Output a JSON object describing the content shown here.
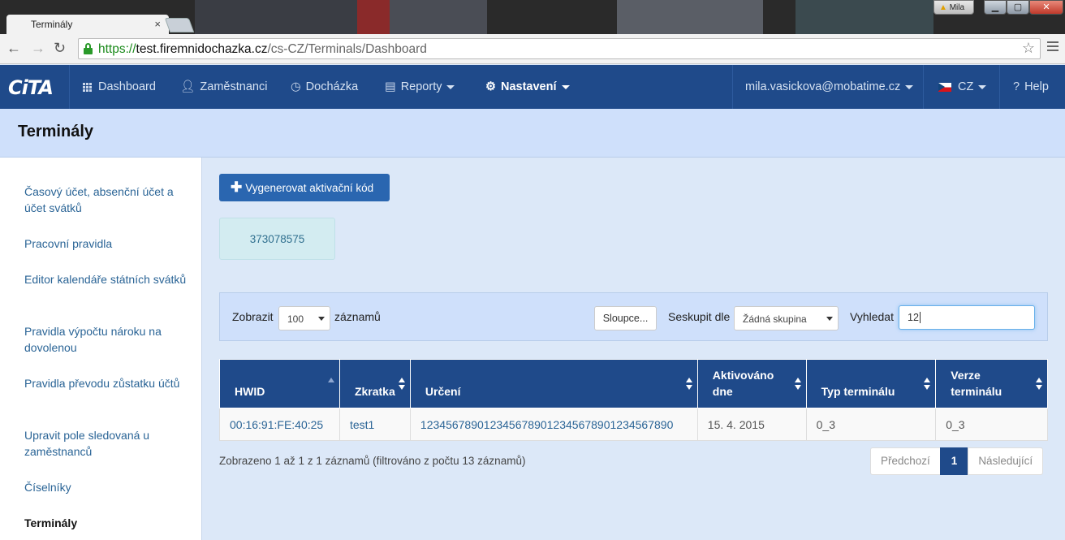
{
  "browser": {
    "tab_title": "Terminály",
    "tab_close": "×",
    "url_proto": "https://",
    "url_host": "test.firemnidochazka.cz",
    "url_path": "/cs-CZ/Terminals/Dashboard",
    "window_user": "Mila"
  },
  "navbar": {
    "brand": "CiTA",
    "items": [
      {
        "label": "Dashboard"
      },
      {
        "label": "Zaměstnanci"
      },
      {
        "label": "Docházka"
      },
      {
        "label": "Reporty"
      },
      {
        "label": "Nastavení"
      }
    ],
    "user_email": "mila.vasickova@mobatime.cz",
    "language": "CZ",
    "help": "Help"
  },
  "page": {
    "title": "Terminály"
  },
  "sidebar": {
    "items": [
      {
        "label": "Časový účet, absenční účet a účet svátků"
      },
      {
        "label": "Pracovní pravidla"
      },
      {
        "label": "Editor kalendáře státních svátků"
      },
      {
        "label": "Pravidla výpočtu nároku na dovolenou"
      },
      {
        "label": "Pravidla převodu zůstatku účtů"
      },
      {
        "label": "Upravit pole sledovaná u zaměstnanců"
      },
      {
        "label": "Číselníky"
      },
      {
        "label": "Terminály"
      }
    ]
  },
  "main": {
    "generate_button": "Vygenerovat aktivační kód",
    "activation_code": "373078575",
    "toolbar": {
      "show_label": "Zobrazit",
      "page_size": "100",
      "records_label": "záznamů",
      "columns_button": "Sloupce...",
      "group_label": "Seskupit dle",
      "group_value": "Žádná skupina",
      "search_label": "Vyhledat",
      "search_value": "12"
    },
    "table": {
      "headers": [
        "HWID",
        "Zkratka",
        "Určení",
        "Aktivováno dne",
        "Typ terminálu",
        "Verze terminálu"
      ],
      "rows": [
        [
          "00:16:91:FE:40:25",
          "test1",
          "1234567890123456789012345678901234567890",
          "15. 4. 2015",
          "0_3",
          "0_3"
        ]
      ]
    },
    "info": "Zobrazeno 1 až 1 z 1 záznamů (filtrováno z počtu 13 záznamů)",
    "pager": {
      "prev": "Předchozí",
      "current": "1",
      "next": "Následující"
    }
  },
  "colors": {
    "navbar": "#1f4a8a",
    "page_bg": "#dce8f8",
    "link": "#2a6496"
  }
}
